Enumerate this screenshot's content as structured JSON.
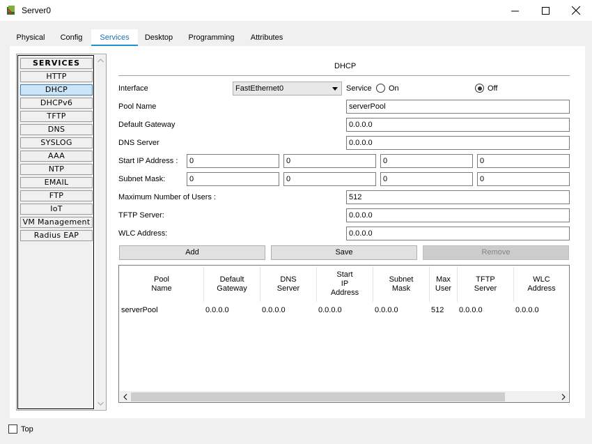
{
  "window": {
    "title": "Server0",
    "icons": [
      "app-icon",
      "minimize-icon",
      "maximize-icon",
      "close-icon"
    ]
  },
  "tabs": [
    {
      "label": "Physical"
    },
    {
      "label": "Config"
    },
    {
      "label": "Services",
      "active": true
    },
    {
      "label": "Desktop"
    },
    {
      "label": "Programming"
    },
    {
      "label": "Attributes"
    }
  ],
  "sidebar": {
    "header": "SERVICES",
    "items": [
      "HTTP",
      "DHCP",
      "DHCPv6",
      "TFTP",
      "DNS",
      "SYSLOG",
      "AAA",
      "NTP",
      "EMAIL",
      "FTP",
      "IoT",
      "VM Management",
      "Radius EAP"
    ],
    "selected": "DHCP"
  },
  "dhcp": {
    "title": "DHCP",
    "interface_label": "Interface",
    "interface_value": "FastEthernet0",
    "service_label": "Service",
    "on_label": "On",
    "off_label": "Off",
    "service_state": "Off",
    "pool_name_label": "Pool Name",
    "pool_name_value": "serverPool",
    "default_gateway_label": "Default Gateway",
    "default_gateway_value": "0.0.0.0",
    "dns_server_label": "DNS Server",
    "dns_server_value": "0.0.0.0",
    "start_ip_label": "Start IP Address :",
    "start_ip": [
      "0",
      "0",
      "0",
      "0"
    ],
    "subnet_mask_label": "Subnet Mask:",
    "subnet_mask": [
      "0",
      "0",
      "0",
      "0"
    ],
    "max_users_label": "Maximum Number of Users :",
    "max_users_value": "512",
    "tftp_server_label": "TFTP Server:",
    "tftp_server_value": "0.0.0.0",
    "wlc_address_label": "WLC Address:",
    "wlc_address_value": "0.0.0.0",
    "add_label": "Add",
    "save_label": "Save",
    "remove_label": "Remove"
  },
  "table": {
    "headers": [
      "Pool\nName",
      "Default\nGateway",
      "DNS\nServer",
      "Start\nIP\nAddress",
      "Subnet\nMask",
      "Max\nUser",
      "TFTP\nServer",
      "WLC\nAddress"
    ],
    "rows": [
      [
        "serverPool",
        "0.0.0.0",
        "0.0.0.0",
        "0.0.0.0",
        "0.0.0.0",
        "512",
        "0.0.0.0",
        "0.0.0.0"
      ]
    ]
  },
  "footer": {
    "top_label": "Top",
    "top_checked": false
  }
}
